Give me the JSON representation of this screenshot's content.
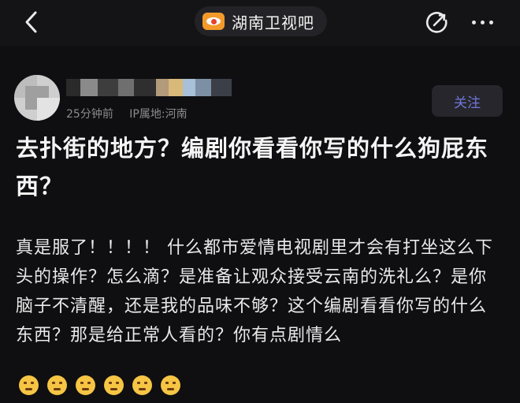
{
  "topbar": {
    "forum_name": "湖南卫视吧"
  },
  "author": {
    "time": "25分钟前",
    "location": "IP属地:河南",
    "follow_label": "关注"
  },
  "post": {
    "title": "去扑街的地方？编剧你看看你写的什么狗屁东西？",
    "body": "真是服了！！！！ 什么都市爱情电视剧里才会有打坐这么下头的操作？怎么滴？是准备让观众接受云南的洗礼么？是你脑子不清醒，还是我的品味不够？这个编剧看看你写的什么东西？那是给正常人看的？你有点剧情么",
    "emoji_count": 6
  },
  "icons": {
    "back": "chevron-left-icon",
    "share": "edit-share-icon",
    "more": "more-dots-icon",
    "emoji": "annoyed-face-emoji"
  },
  "colors": {
    "background": "#0f0f11",
    "follow_text": "#6f77d8",
    "forum_logo": "#f39a2a"
  }
}
